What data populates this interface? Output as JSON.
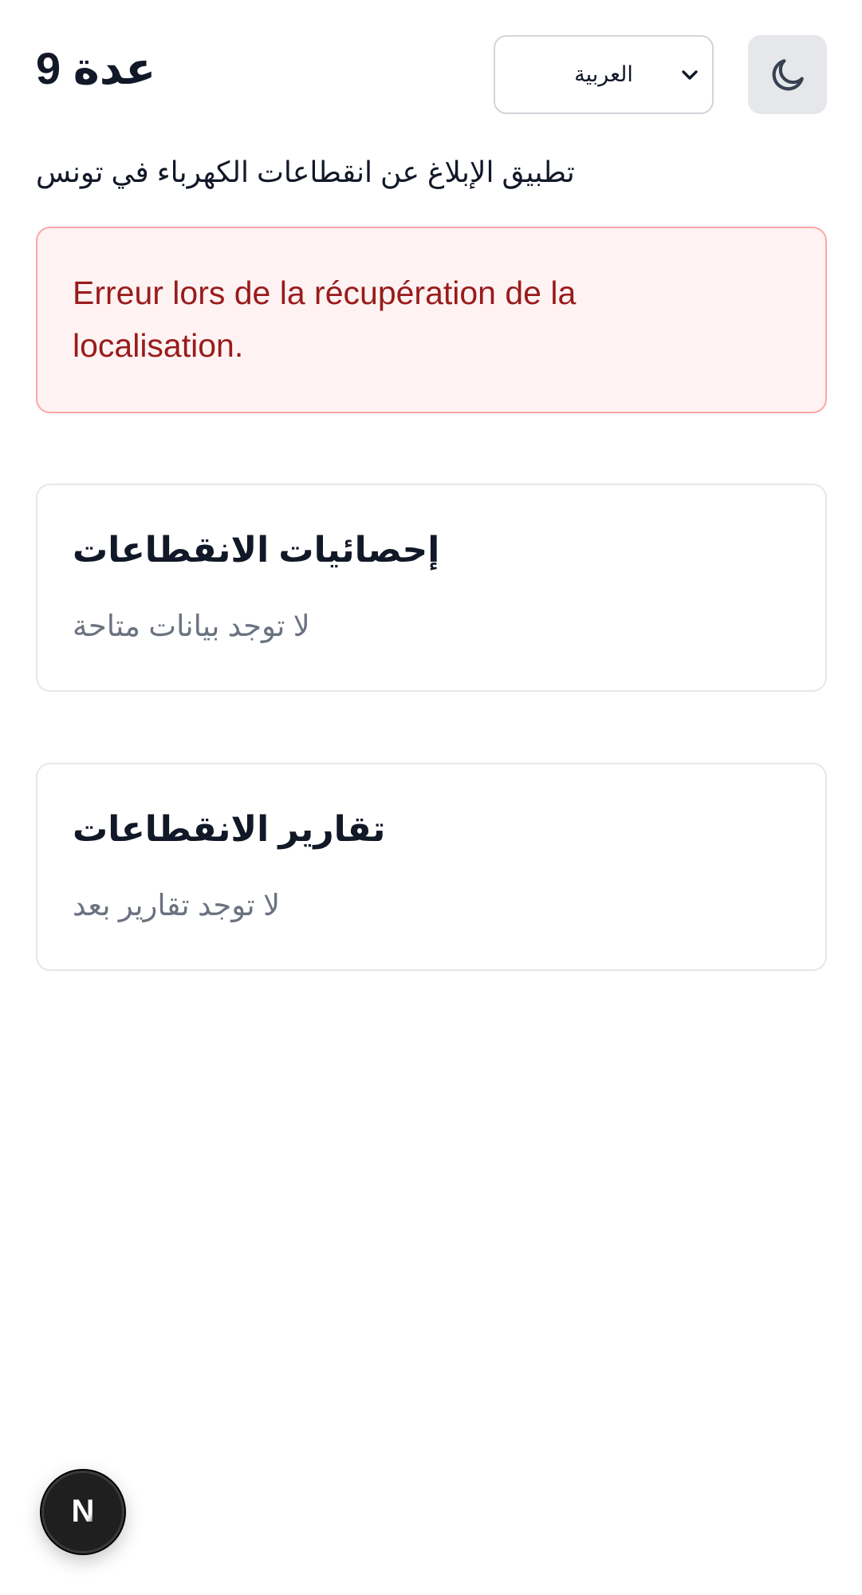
{
  "header": {
    "app_title": "عدة 9",
    "language_select": {
      "selected": "العربية",
      "options": [
        "العربية"
      ]
    },
    "theme_toggle_icon": "moon-icon"
  },
  "subtitle": "تطبيق الإبلاغ عن انقطاعات الكهرباء في تونس",
  "error_alert": {
    "message": "Erreur lors de la récupération de la localisation."
  },
  "stats_card": {
    "title": "إحصائيات الانقطاعات",
    "empty_text": "لا توجد بيانات متاحة"
  },
  "reports_card": {
    "title": "تقارير الانقطاعات",
    "empty_text": "لا توجد تقارير بعد"
  },
  "dev_badge": {
    "icon": "nextjs-logo-icon",
    "letter": "N"
  },
  "colors": {
    "error_text": "#991b1b",
    "error_bg": "#fef2f2",
    "error_border": "#fca5a5",
    "muted_text": "#6b7280",
    "toggle_bg": "#e5e7eb"
  }
}
